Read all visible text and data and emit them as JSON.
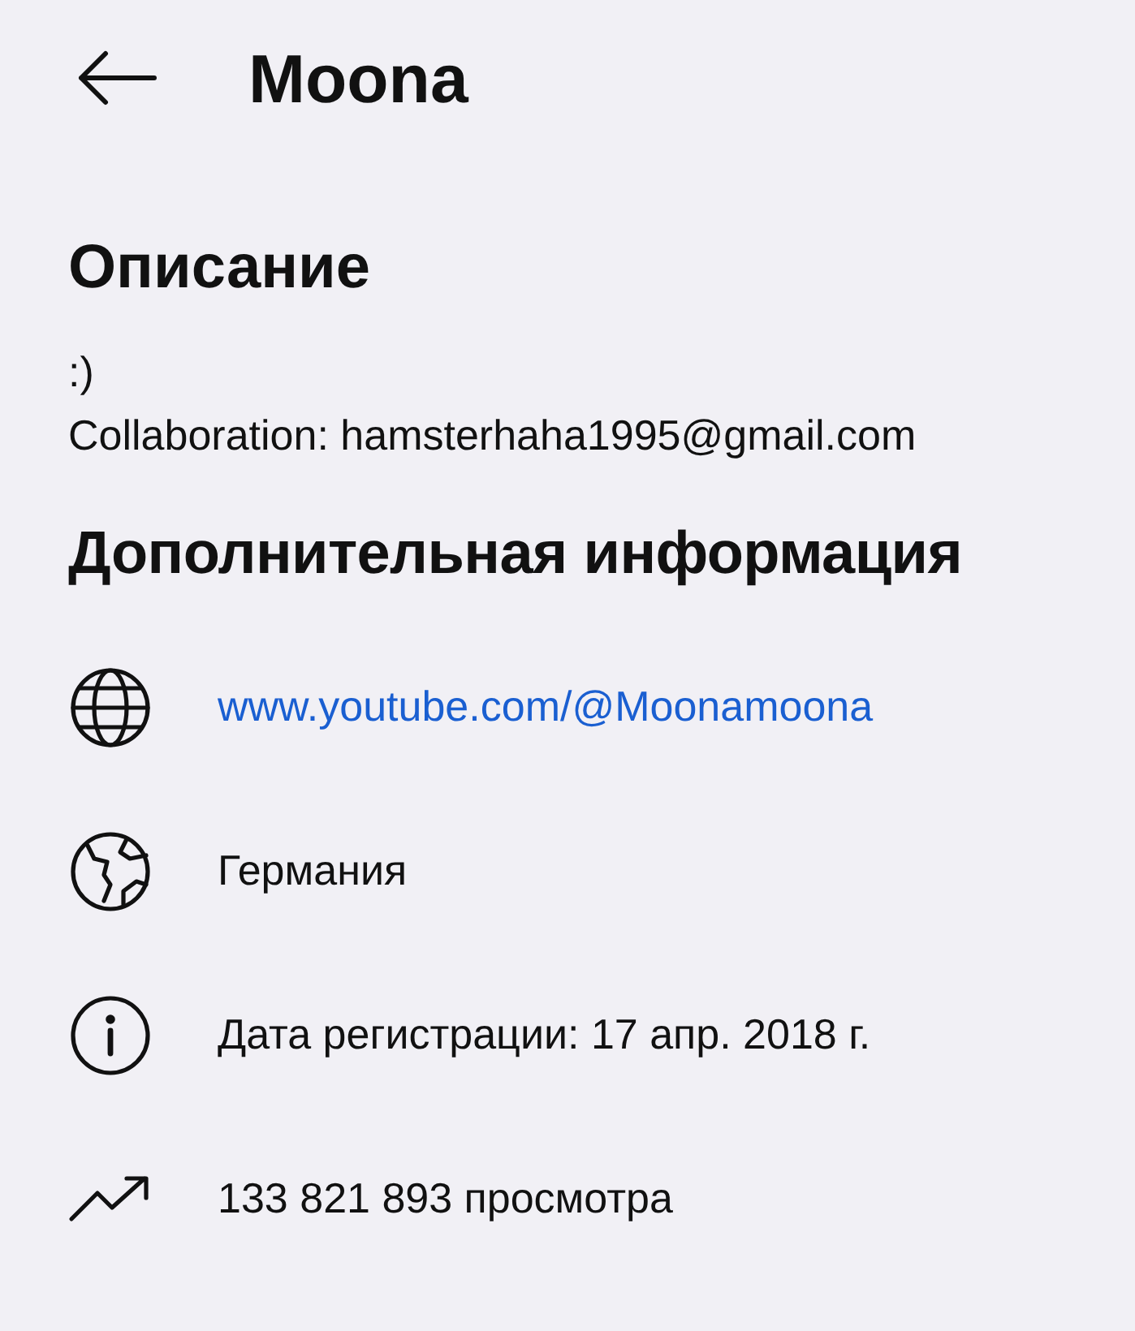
{
  "header": {
    "title": "Moona"
  },
  "description": {
    "heading": "Описание",
    "lines": [
      ":)",
      "Collaboration: hamsterhaha1995@gmail.com"
    ]
  },
  "details": {
    "heading": "Дополнительная информация",
    "items": [
      {
        "kind": "link",
        "text": "www.youtube.com/@Moonamoona"
      },
      {
        "kind": "country",
        "text": "Германия"
      },
      {
        "kind": "joined",
        "text": "Дата регистрации: 17 апр. 2018 г."
      },
      {
        "kind": "views",
        "text": "133 821 893 просмотра"
      }
    ]
  }
}
